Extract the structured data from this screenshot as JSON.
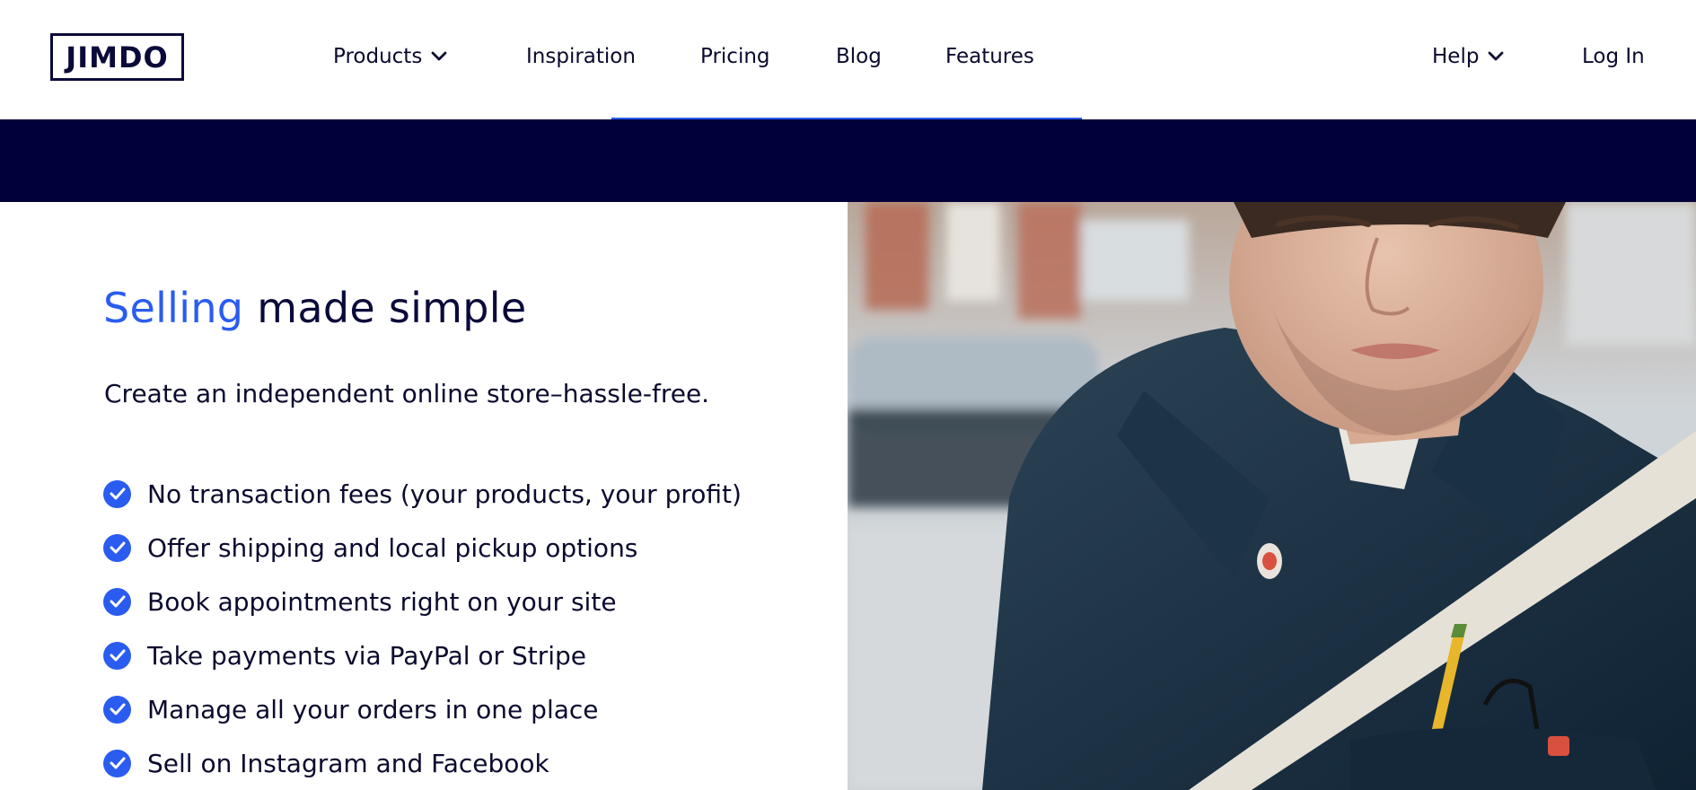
{
  "header": {
    "logo": "JIMDO",
    "nav": {
      "products": "Products",
      "inspiration": "Inspiration",
      "pricing": "Pricing",
      "blog": "Blog",
      "features": "Features",
      "help": "Help",
      "login": "Log In"
    }
  },
  "hero": {
    "headline_accent": "Selling",
    "headline_rest": " made simple",
    "subhead": "Create an independent online store–hassle-free.",
    "features": [
      "No transaction fees (your products, your profit)",
      "Offer shipping and local pickup options",
      "Book appointments right on your site",
      "Take payments via PayPal or Stripe",
      "Manage all your orders in one place",
      "Sell on Instagram and Facebook"
    ]
  },
  "icons": {
    "check": "check-circle-icon",
    "chevron": "chevron-down-icon"
  },
  "colors": {
    "accent": "#2a5cf0",
    "navy": "#02003a",
    "text": "#0a0a2e"
  }
}
